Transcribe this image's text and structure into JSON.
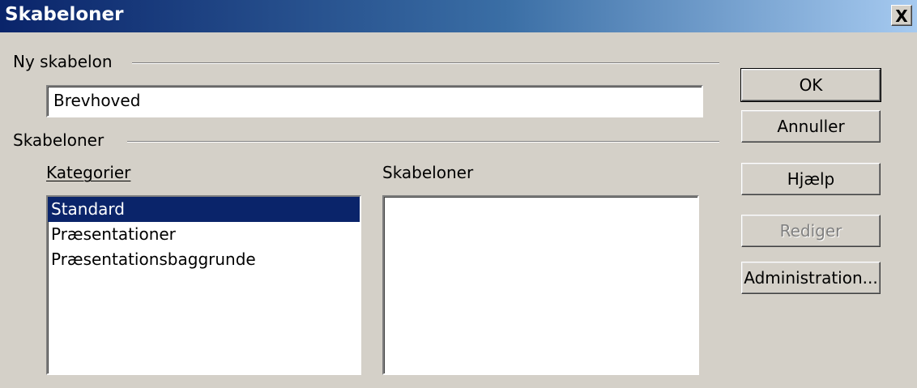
{
  "window": {
    "title": "Skabeloner",
    "close_label": "X"
  },
  "new_template": {
    "group_label": "Ny skabelon",
    "name_value": "Brevhoved"
  },
  "templates": {
    "group_label": "Skabeloner",
    "categories_label": "Kategorier",
    "templates_label": "Skabeloner",
    "categories": [
      "Standard",
      "Præsentationer",
      "Præsentationsbaggrunde"
    ],
    "selected_category": "Standard",
    "template_items": []
  },
  "buttons": {
    "ok": "OK",
    "cancel": "Annuller",
    "help": "Hjælp",
    "edit": "Rediger",
    "admin": "Administration..."
  }
}
